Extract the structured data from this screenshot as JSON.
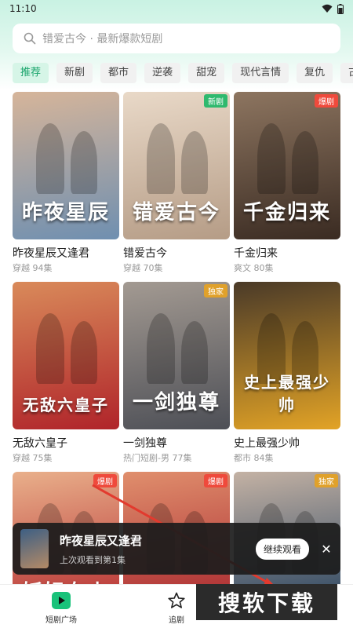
{
  "status_bar": {
    "time": "11:10"
  },
  "search": {
    "placeholder": "错爱古今 · 最新爆款短剧"
  },
  "categories": [
    "推荐",
    "新剧",
    "都市",
    "逆袭",
    "甜宠",
    "现代言情",
    "复仇",
    "古"
  ],
  "dramas": [
    {
      "title": "昨夜星辰又逢君",
      "meta": "穿越 94集",
      "badge": "",
      "art": "昨夜星辰",
      "colors": [
        "#6f8fb0",
        "#d6b59a"
      ]
    },
    {
      "title": "错爱古今",
      "meta": "穿越 70集",
      "badge": "新剧",
      "badge_color": "#2fb96e",
      "art": "错爱古今",
      "colors": [
        "#b59c86",
        "#e9d9c8"
      ]
    },
    {
      "title": "千金归来",
      "meta": "爽文 80集",
      "badge": "爆剧",
      "badge_color": "#ef4a3c",
      "art": "千金归来",
      "colors": [
        "#3a2b22",
        "#8d7560"
      ]
    },
    {
      "title": "无敌六皇子",
      "meta": "穿越 75集",
      "badge": "",
      "art": "无敌六皇子",
      "colors": [
        "#b0242a",
        "#d98a5a"
      ]
    },
    {
      "title": "一剑独尊",
      "meta": "热门短剧-男 77集",
      "badge": "独家",
      "badge_color": "#e0a12b",
      "art": "一剑独尊",
      "colors": [
        "#4d4f56",
        "#a39a92"
      ]
    },
    {
      "title": "史上最强少帅",
      "meta": "都市 84集",
      "badge": "",
      "art": "史上最强少帅",
      "colors": [
        "#e2a326",
        "#4a3a28"
      ]
    },
    {
      "title": "",
      "meta": "",
      "badge": "爆剧",
      "badge_color": "#ef4a3c",
      "art": "妖妃在上",
      "colors": [
        "#b3262b",
        "#e9b08b"
      ]
    },
    {
      "title": "",
      "meta": "",
      "badge": "爆剧",
      "badge_color": "#ef4a3c",
      "art": "",
      "colors": [
        "#a6202a",
        "#e08f6d"
      ]
    },
    {
      "title": "",
      "meta": "",
      "badge": "独家",
      "badge_color": "#e0a12b",
      "art": "",
      "colors": [
        "#1f3d5c",
        "#c4b2a4"
      ]
    }
  ],
  "continue_watching": {
    "title": "昨夜星辰又逢君",
    "subtitle": "上次观看到第1集",
    "button": "继续观看"
  },
  "tabs": [
    {
      "label": "短剧广场",
      "icon": "play-icon",
      "active": true
    },
    {
      "label": "追剧",
      "icon": "star-icon",
      "active": false
    }
  ],
  "watermark": "搜软下载"
}
